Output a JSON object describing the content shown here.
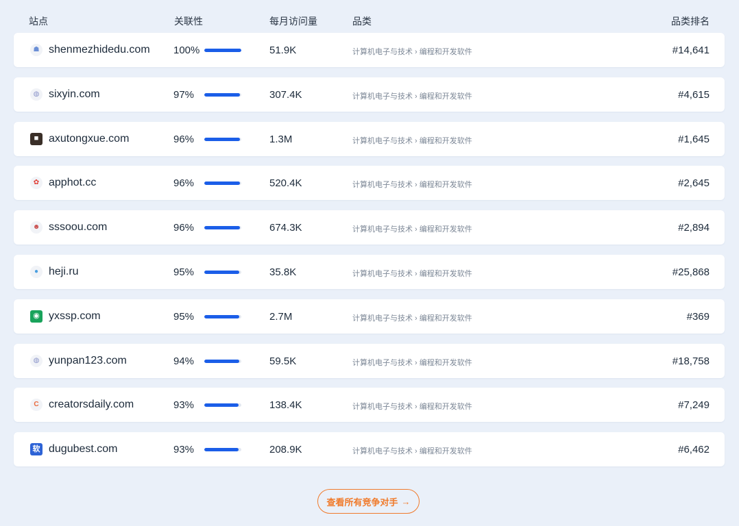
{
  "columns": {
    "site": "站点",
    "relevance": "关联性",
    "monthly_visits": "每月访问量",
    "category": "品类",
    "category_rank": "品类排名"
  },
  "rows": [
    {
      "domain": "shenmezhidedu.com",
      "relevance": "100%",
      "relevance_value": 1.0,
      "visits": "51.9K",
      "category": "计算机电子与技术 › 编程和开发软件",
      "rank": "#14,641",
      "favicon_icon": "blue-figure-icon",
      "favicon_color": "#6b8fd6"
    },
    {
      "domain": "sixyin.com",
      "relevance": "97%",
      "relevance_value": 0.97,
      "visits": "307.4K",
      "category": "计算机电子与技术 › 编程和开发软件",
      "rank": "#4,615",
      "favicon_icon": "globe-icon",
      "favicon_color": "#8a93c9"
    },
    {
      "domain": "axutongxue.com",
      "relevance": "96%",
      "relevance_value": 0.96,
      "visits": "1.3M",
      "category": "计算机电子与技术 › 编程和开发软件",
      "rank": "#1,645",
      "favicon_icon": "person-photo-icon",
      "favicon_color": "#3a2f28"
    },
    {
      "domain": "apphot.cc",
      "relevance": "96%",
      "relevance_value": 0.96,
      "visits": "520.4K",
      "category": "计算机电子与技术 › 编程和开发软件",
      "rank": "#2,645",
      "favicon_icon": "red-logo-icon",
      "favicon_color": "#e03a32"
    },
    {
      "domain": "sssoou.com",
      "relevance": "96%",
      "relevance_value": 0.96,
      "visits": "674.3K",
      "category": "计算机电子与技术 › 编程和开发软件",
      "rank": "#2,894",
      "favicon_icon": "face-icon",
      "favicon_color": "#c94b4b"
    },
    {
      "domain": "heji.ru",
      "relevance": "95%",
      "relevance_value": 0.95,
      "visits": "35.8K",
      "category": "计算机电子与技术 › 编程和开发软件",
      "rank": "#25,868",
      "favicon_icon": "circle-dot-icon",
      "favicon_color": "#4a9fe0"
    },
    {
      "domain": "yxssp.com",
      "relevance": "95%",
      "relevance_value": 0.95,
      "visits": "2.7M",
      "category": "计算机电子与技术 › 编程和开发软件",
      "rank": "#369",
      "favicon_icon": "green-square-icon",
      "favicon_color": "#19a35b"
    },
    {
      "domain": "yunpan123.com",
      "relevance": "94%",
      "relevance_value": 0.94,
      "visits": "59.5K",
      "category": "计算机电子与技术 › 编程和开发软件",
      "rank": "#18,758",
      "favicon_icon": "globe-icon",
      "favicon_color": "#8a93c9"
    },
    {
      "domain": "creatorsdaily.com",
      "relevance": "93%",
      "relevance_value": 0.93,
      "visits": "138.4K",
      "category": "计算机电子与技术 › 编程和开发软件",
      "rank": "#7,249",
      "favicon_icon": "letter-c-icon",
      "favicon_color": "#ea6a3d"
    },
    {
      "domain": "dugubest.com",
      "relevance": "93%",
      "relevance_value": 0.93,
      "visits": "208.9K",
      "category": "计算机电子与技术 › 编程和开发软件",
      "rank": "#6,462",
      "favicon_icon": "blue-square-logo-icon",
      "favicon_color": "#2d63d6"
    }
  ],
  "view_all_button": {
    "label": "查看所有竞争对手",
    "icon": "arrow-right-icon"
  },
  "colors": {
    "background": "#eaf0f9",
    "bar_fill": "#1b5ee8",
    "bar_track": "#e3e8f0",
    "accent": "#f07a2b"
  }
}
